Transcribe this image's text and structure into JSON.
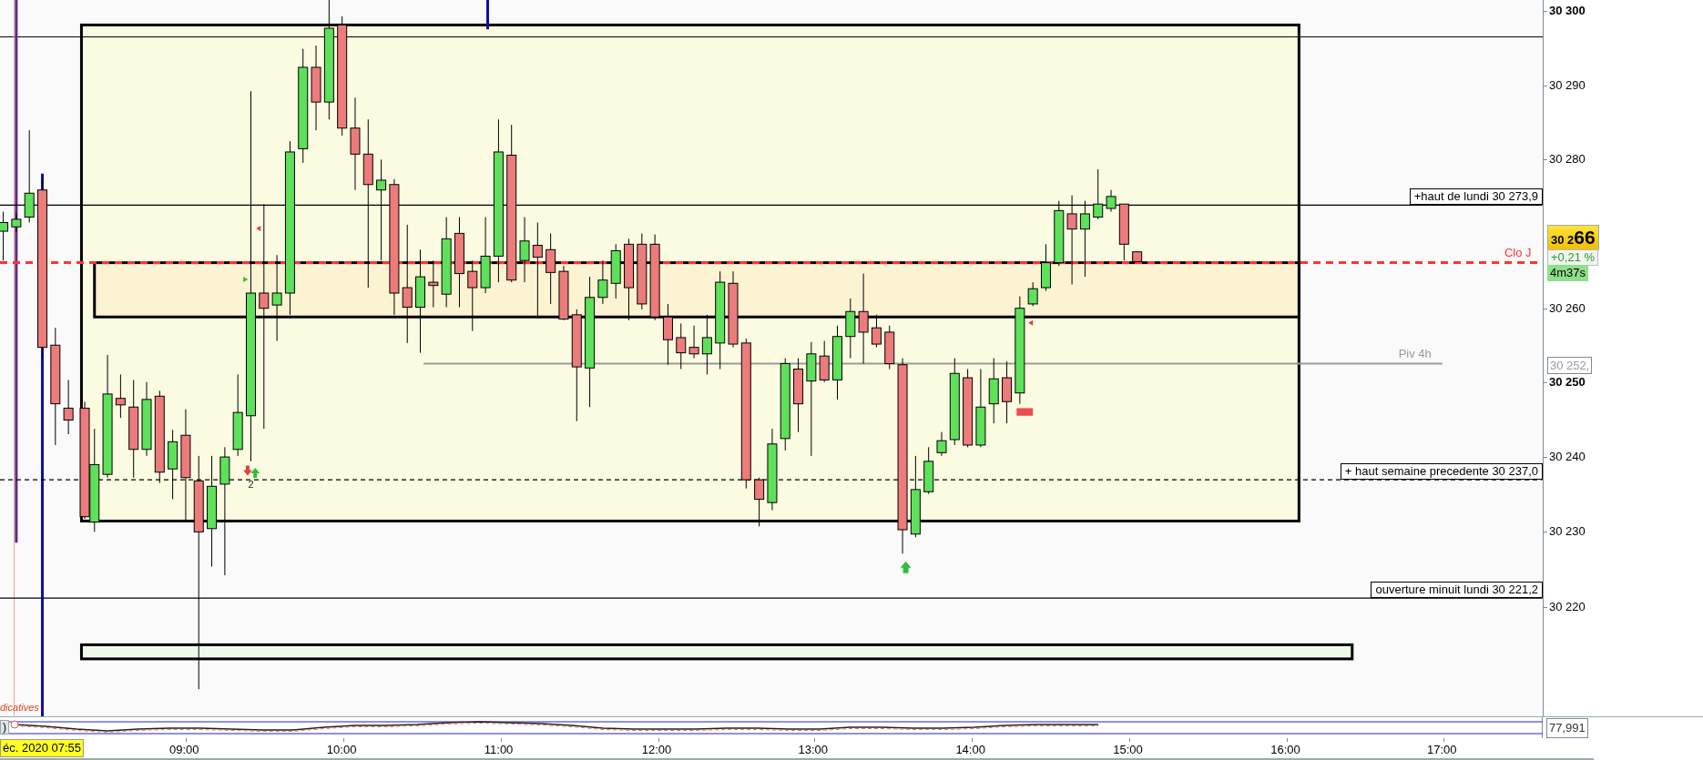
{
  "chart": {
    "levels": [
      {
        "label": "+haut de lundi 30 273,9",
        "kind": "boxed"
      },
      {
        "label": "Clo J",
        "kind": "plain"
      },
      {
        "label": "Piv 4h",
        "kind": "plain"
      },
      {
        "label": "+ haut semaine precedente 30 237,0",
        "kind": "boxed"
      },
      {
        "label": "ouverture minuit lundi 30 221,2",
        "kind": "boxed"
      }
    ],
    "signal_count": "2",
    "indicator_legend": "dicatives"
  },
  "price_axis": {
    "ticks": [
      {
        "label": "30 300",
        "major": true
      },
      {
        "label": "30 290",
        "major": false
      },
      {
        "label": "30 280",
        "major": false
      },
      {
        "label": "30 260",
        "major": false
      },
      {
        "label": "30 250",
        "major": true
      },
      {
        "label": "30 240",
        "major": false
      },
      {
        "label": "30 230",
        "major": false
      },
      {
        "label": "30 220",
        "major": false
      }
    ],
    "current_price": {
      "head": "30 2",
      "tail": "66",
      "change": "+0,21 %",
      "countdown": "4m37s"
    },
    "pivot_tag": "30 252,"
  },
  "oscillator": {
    "button": ")",
    "value": "77,991"
  },
  "time_axis": {
    "cursor_label": "éc. 2020 07:55",
    "ticks": [
      "09:00",
      "10:00",
      "11:00",
      "12:00",
      "13:00",
      "14:00",
      "15:00",
      "16:00",
      "17:00"
    ]
  }
}
